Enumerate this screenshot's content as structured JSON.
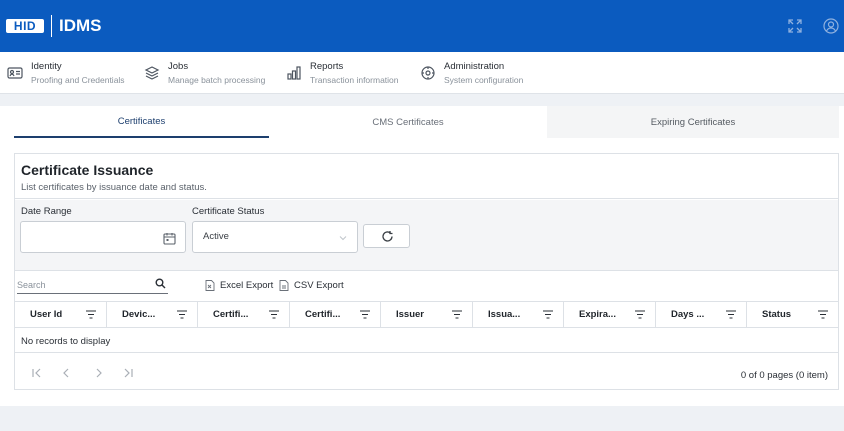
{
  "header": {
    "logo_text": "HID",
    "app_name": "IDMS",
    "icons": [
      "fullscreen-icon",
      "user-account-icon"
    ],
    "brand_color": "#0b5bbf"
  },
  "nav": {
    "items": [
      {
        "title": "Identity",
        "subtitle": "Proofing and Credentials",
        "icon": "id-card-icon"
      },
      {
        "title": "Jobs",
        "subtitle": "Manage batch processing",
        "icon": "layers-icon"
      },
      {
        "title": "Reports",
        "subtitle": "Transaction information",
        "icon": "bar-chart-icon"
      },
      {
        "title": "Administration",
        "subtitle": "System configuration",
        "icon": "settings-icon"
      }
    ]
  },
  "tabs": [
    {
      "label": "Certificates",
      "active": true
    },
    {
      "label": "CMS Certificates",
      "active": false
    },
    {
      "label": "Expiring Certificates",
      "active": false
    }
  ],
  "card": {
    "title": "Certificate Issuance",
    "subtitle": "List certificates by issuance date and status."
  },
  "filters": {
    "date_range_label": "Date Range",
    "date_range_value": "",
    "status_label": "Certificate Status",
    "status_value": "Active"
  },
  "toolbar": {
    "search_placeholder": "Search",
    "excel_export": "Excel Export",
    "csv_export": "CSV Export"
  },
  "grid": {
    "columns": [
      "User Id",
      "Devic...",
      "Certifi...",
      "Certifi...",
      "Issuer",
      "Issua...",
      "Expira...",
      "Days ...",
      "Status"
    ],
    "rows": [],
    "empty_message": "No records to display"
  },
  "pager": {
    "info": "0 of 0 pages (0 item)"
  }
}
